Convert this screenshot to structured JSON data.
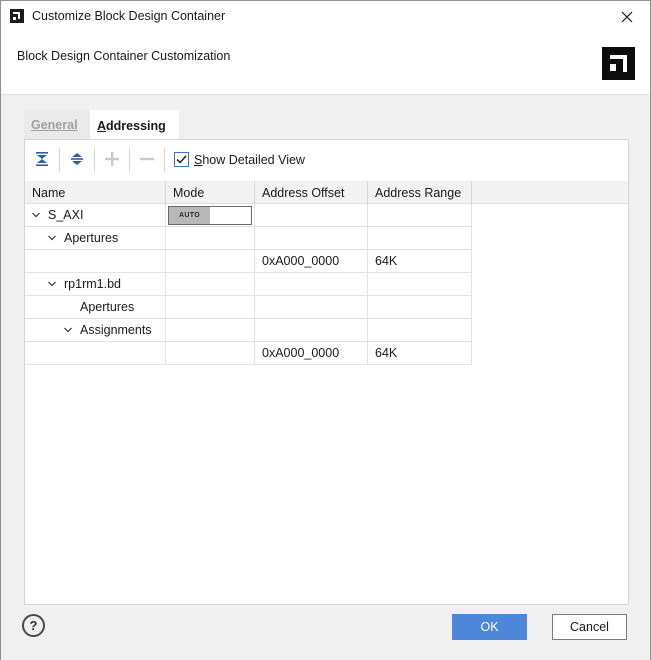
{
  "window": {
    "title": "Customize Block Design Container"
  },
  "header": {
    "title": "Block Design Container Customization"
  },
  "tabs": [
    {
      "label": "General",
      "active": false
    },
    {
      "label_underlined": "A",
      "label_rest": "ddressing",
      "active": true
    }
  ],
  "toolbar": {
    "icons": [
      "collapse-all-icon",
      "expand-all-icon",
      "add-icon",
      "remove-icon"
    ],
    "show_detailed_view": {
      "label_underlined": "S",
      "label_rest": "how Detailed View",
      "checked": true
    }
  },
  "table": {
    "columns": [
      "Name",
      "Mode",
      "Address Offset",
      "Address Range"
    ],
    "rows": [
      {
        "name": "S_AXI",
        "expandable": true,
        "mode": "AUTO",
        "offset": "",
        "range": ""
      },
      {
        "name": "Apertures",
        "expandable": true,
        "mode": "",
        "offset": "",
        "range": ""
      },
      {
        "name": "",
        "expandable": false,
        "mode": "",
        "offset": "0xA000_0000",
        "range": "64K"
      },
      {
        "name": "rp1rm1.bd",
        "expandable": true,
        "mode": "",
        "offset": "",
        "range": ""
      },
      {
        "name": "Apertures",
        "expandable": false,
        "mode": "",
        "offset": "",
        "range": ""
      },
      {
        "name": "Assignments",
        "expandable": true,
        "mode": "",
        "offset": "",
        "range": ""
      },
      {
        "name": "",
        "expandable": false,
        "mode": "",
        "offset": "0xA000_0000",
        "range": "64K"
      }
    ]
  },
  "footer": {
    "help_label": "?",
    "ok_label": "OK",
    "cancel_label": "Cancel"
  },
  "colors": {
    "primary_button": "#4e86d8",
    "checkbox_accent": "#3d74c9"
  }
}
